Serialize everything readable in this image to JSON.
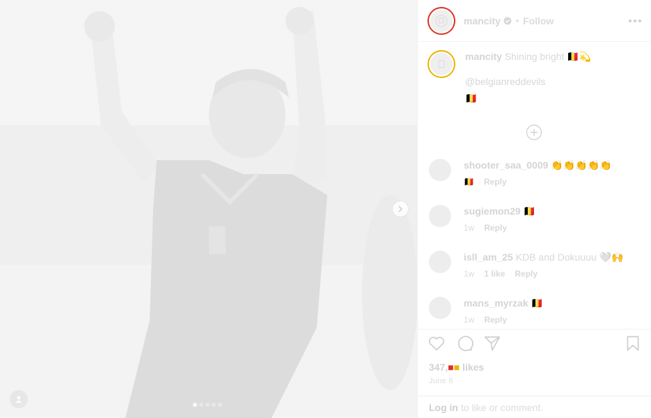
{
  "header": {
    "username": "mancity",
    "separator": "•",
    "follow_label": "Follow"
  },
  "caption": {
    "username": "mancity",
    "text": "Shining bright 🇧🇪💫",
    "mention": "@belgianreddevils",
    "emoji": "🇧🇪"
  },
  "comments": [
    {
      "username": "shooter_saa_0009",
      "text": "👏👏👏👏👏",
      "time": "🇧🇪",
      "likes": "",
      "reply": "Reply"
    },
    {
      "username": "sugiemon29",
      "text": "🇧🇪",
      "time": "1w",
      "likes": "",
      "reply": "Reply"
    },
    {
      "username": "isll_am_25",
      "text": "KDB and Dokuuuu 🤍🙌",
      "time": "1w",
      "likes": "1 like",
      "reply": "Reply"
    },
    {
      "username": "mans_myrzak",
      "text": "🇧🇪",
      "time": "1w",
      "likes": "",
      "reply": "Reply"
    }
  ],
  "post": {
    "likes": "347,",
    "likes_suffix": "likes",
    "date": "June 6"
  },
  "login_bar": {
    "login_label": "Log in",
    "rest": "to like or comment."
  },
  "carousel": {
    "slides": 5,
    "active_index": 0
  },
  "colors": {
    "accent_red": "#e03020",
    "accent_yellow": "#e8b400"
  },
  "icons": [
    "chevron-right-icon",
    "user-tag-icon",
    "verified-icon",
    "more-icon",
    "add-circle-icon",
    "heart-icon",
    "comment-icon",
    "share-icon",
    "bookmark-icon",
    "city-crest-icon"
  ]
}
